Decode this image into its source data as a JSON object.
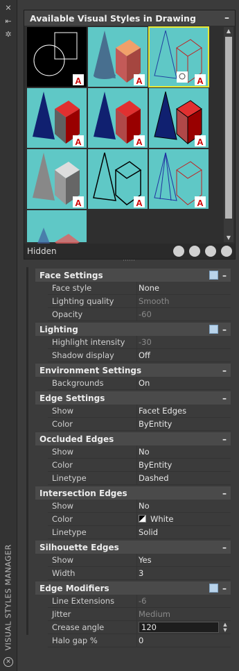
{
  "sidebar": {
    "title": "VISUAL STYLES MANAGER",
    "icons": [
      "close-x-icon",
      "autohide-icon",
      "properties-icon"
    ]
  },
  "gallery": {
    "title": "Available Visual Styles in Drawing",
    "collapse": "–",
    "current_style": "Hidden",
    "items": [
      {
        "icon": "2d-wireframe-thumb"
      },
      {
        "icon": "conceptual-thumb"
      },
      {
        "icon": "hidden-thumb",
        "selected": true
      },
      {
        "icon": "realistic-thumb"
      },
      {
        "icon": "shaded-thumb"
      },
      {
        "icon": "shaded-with-edges-thumb"
      },
      {
        "icon": "shades-of-gray-thumb"
      },
      {
        "icon": "sketchy-thumb"
      },
      {
        "icon": "wireframe-thumb"
      },
      {
        "icon": "x-ray-thumb"
      }
    ],
    "tools": [
      "create-style-icon",
      "apply-style-icon",
      "export-tool-palette-icon",
      "delete-style-icon"
    ]
  },
  "sections": [
    {
      "title": "Face Settings",
      "icon": "face-settings-icon",
      "rows": [
        {
          "k": "Face style",
          "v": "None"
        },
        {
          "k": "Lighting quality",
          "v": "Smooth",
          "dim": true
        },
        {
          "k": "Opacity",
          "v": "-60",
          "dim": true
        }
      ]
    },
    {
      "title": "Lighting",
      "icon": "lighting-icon",
      "rows": [
        {
          "k": "Highlight intensity",
          "v": "-30",
          "dim": true
        },
        {
          "k": "Shadow display",
          "v": "Off"
        }
      ]
    },
    {
      "title": "Environment Settings",
      "rows": [
        {
          "k": "Backgrounds",
          "v": "On"
        }
      ]
    },
    {
      "title": "Edge Settings",
      "rows": [
        {
          "k": "Show",
          "v": "Facet Edges"
        },
        {
          "k": "Color",
          "v": "ByEntity"
        }
      ]
    },
    {
      "title": "Occluded Edges",
      "rows": [
        {
          "k": "Show",
          "v": "No"
        },
        {
          "k": "Color",
          "v": "ByEntity"
        },
        {
          "k": "Linetype",
          "v": "Dashed"
        }
      ]
    },
    {
      "title": "Intersection Edges",
      "rows": [
        {
          "k": "Show",
          "v": "No"
        },
        {
          "k": "Color",
          "v": "White",
          "swatch": true
        },
        {
          "k": "Linetype",
          "v": "Solid"
        }
      ]
    },
    {
      "title": "Silhouette Edges",
      "rows": [
        {
          "k": "Show",
          "v": "Yes"
        },
        {
          "k": "Width",
          "v": "3"
        }
      ]
    },
    {
      "title": "Edge Modifiers",
      "icon": "edge-modifiers-icon",
      "rows": [
        {
          "k": "Line Extensions",
          "v": "-6",
          "dim": true
        },
        {
          "k": "Jitter",
          "v": "Medium",
          "dim": true
        },
        {
          "k": "Crease angle",
          "v": "120",
          "edit": true
        },
        {
          "k": "Halo gap %",
          "v": "0"
        }
      ]
    }
  ]
}
